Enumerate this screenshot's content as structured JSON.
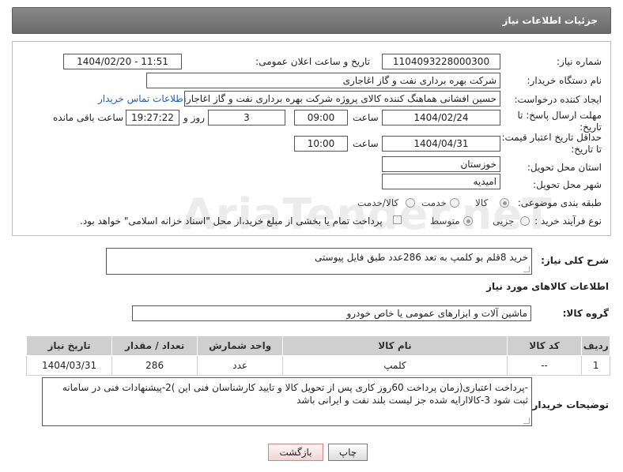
{
  "header": {
    "title": "جزئیات اطلاعات نیاز"
  },
  "watermark": "AriaTender.neT",
  "form": {
    "need_number_label": "شماره نیاز:",
    "need_number": "1104093228000300",
    "announce_label": "تاریخ و ساعت اعلان عمومی:",
    "announce_value": "1404/02/20 - 11:51",
    "buyer_org_label": "نام دستگاه خریدار:",
    "buyer_org": "شرکت بهره برداری نفت و گاز اغاجاری",
    "requester_label": "ایجاد کننده درخواست:",
    "requester": "حسین افشانی هماهنگ کننده کالای پروژه شرکت بهره برداری نفت و گاز اغاجاری",
    "contact_link": "اطلاعات تماس خریدار",
    "reply_deadline_label_1": "مهلت ارسال پاسخ: تا",
    "reply_deadline_label_2": "تاریخ:",
    "reply_date": "1404/02/24",
    "time_label": "ساعت",
    "reply_time": "09:00",
    "days_value": "3",
    "days_label": "روز و",
    "remaining_time": "19:27:22",
    "remaining_label": "ساعت باقی مانده",
    "price_deadline_label_1": "حداقل تاریخ اعتبار قیمت:",
    "price_deadline_label_2": "تا تاریخ:",
    "price_date": "1404/04/31",
    "price_time": "10:00",
    "province_label": "استان محل تحویل:",
    "province": "خوزستان",
    "city_label": "شهر محل تحویل:",
    "city": "امیدیه",
    "category_label": "طبقه بندی موضوعی:",
    "category_options": [
      "کالا",
      "خدمت",
      "کالا/خدمت"
    ],
    "category_selected": "کالا",
    "process_label": "نوع فرآیند خرید :",
    "process_options": [
      "جزیی",
      "متوسط"
    ],
    "process_selected": "متوسط",
    "payment_note": "پرداخت تمام یا بخشی از مبلغ خرید،از محل \"اسناد خزانه اسلامی\" خواهد بود."
  },
  "summary": {
    "label": "شرح کلی نیاز:",
    "text": "خرید 8قلم بو کلمپ به تعد 286عدد طبق فایل پیوستی"
  },
  "goods": {
    "section_title": "اطلاعات کالاهای مورد نیاز",
    "group_label": "گروه کالا:",
    "group_value": "ماشین آلات و ابزارهای عمومی یا خاص خودرو",
    "columns": [
      "ردیف",
      "کد کالا",
      "نام کالا",
      "واحد شمارش",
      "تعداد / مقدار",
      "تاریخ نیاز"
    ],
    "rows": [
      {
        "row": "1",
        "code": "--",
        "name": "کلمپ",
        "unit": "عدد",
        "qty": "286",
        "date": "1404/03/31"
      }
    ]
  },
  "notes": {
    "label": "توضیحات خریدار:",
    "text": "-پرداخت اعتباری(زمان پرداخت 60روز کاری پس از تحویل کالا و تایید کارشناسان فنی این )2-پیشنهادات فنی در سامانه ثبت شود 3-کالاارایه شده جز لیست بلند نفت و ایرانی باشد"
  },
  "buttons": {
    "print": "چاپ",
    "back": "بازگشت"
  }
}
